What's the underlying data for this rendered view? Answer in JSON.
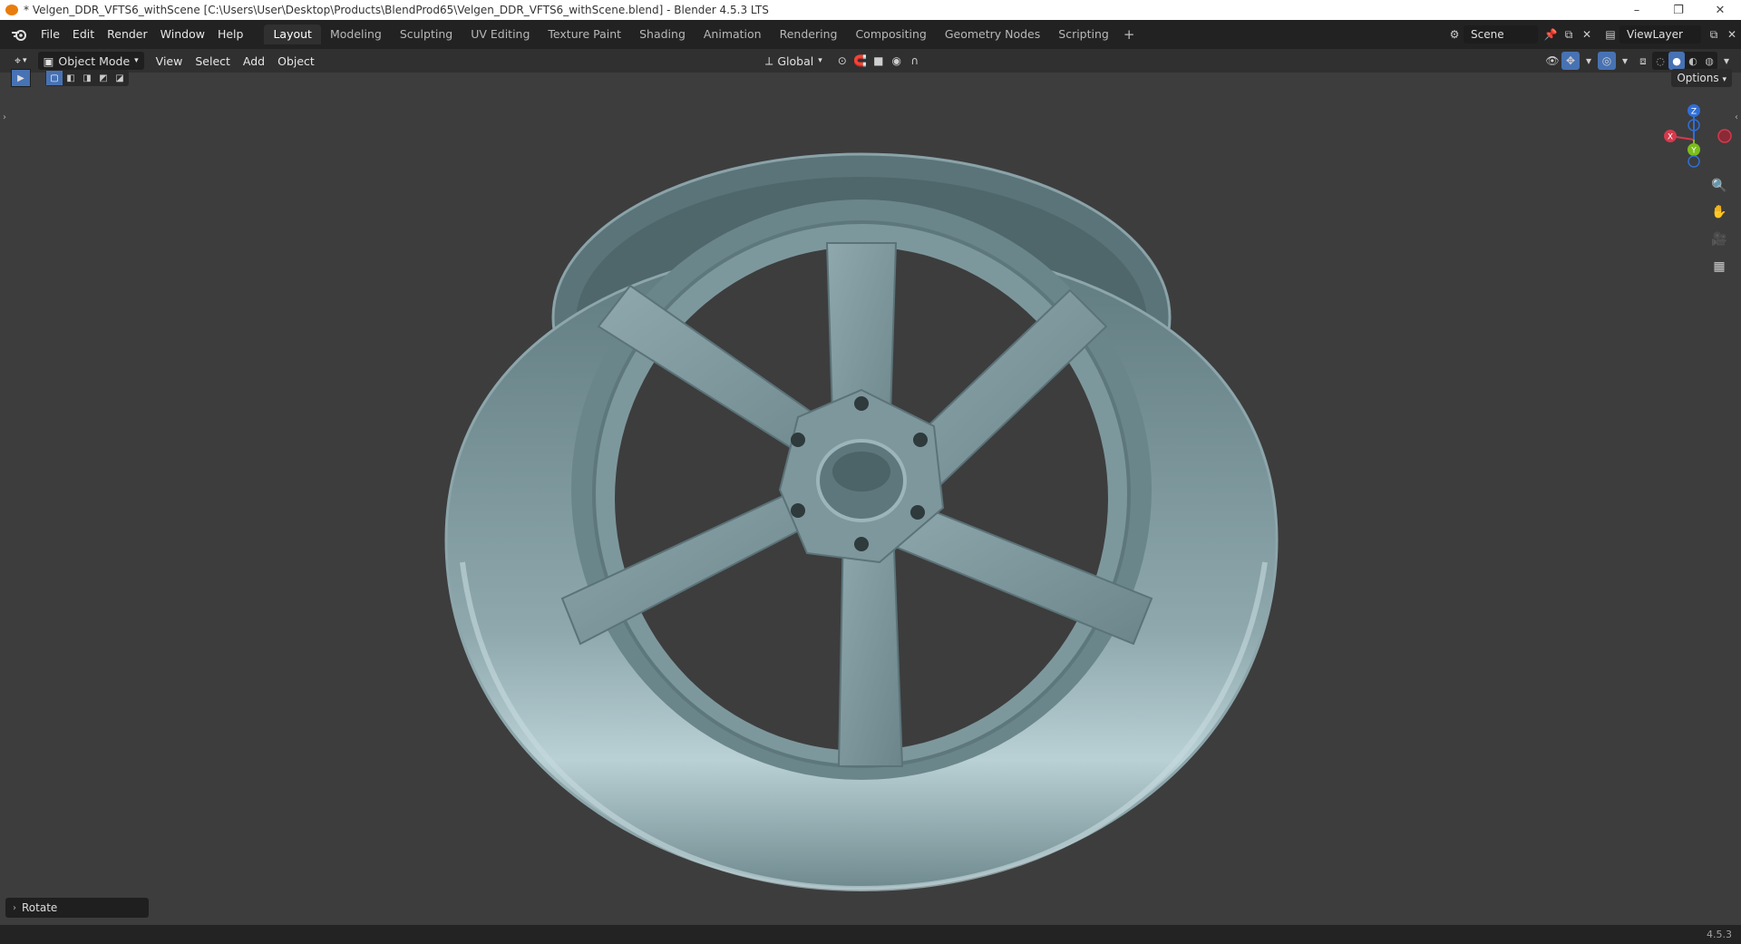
{
  "window": {
    "title": "* Velgen_DDR_VFTS6_withScene [C:\\Users\\User\\Desktop\\Products\\BlendProd65\\Velgen_DDR_VFTS6_withScene.blend] - Blender 4.5.3 LTS",
    "minimize": "–",
    "restore": "❐",
    "close": "✕"
  },
  "menu": {
    "file": "File",
    "edit": "Edit",
    "render": "Render",
    "window": "Window",
    "help": "Help"
  },
  "workspaces": [
    {
      "label": "Layout",
      "active": true
    },
    {
      "label": "Modeling"
    },
    {
      "label": "Sculpting"
    },
    {
      "label": "UV Editing"
    },
    {
      "label": "Texture Paint"
    },
    {
      "label": "Shading"
    },
    {
      "label": "Animation"
    },
    {
      "label": "Rendering"
    },
    {
      "label": "Compositing"
    },
    {
      "label": "Geometry Nodes"
    },
    {
      "label": "Scripting"
    }
  ],
  "workspace_add": "+",
  "scene": {
    "name": "Scene",
    "view_layer": "ViewLayer"
  },
  "header": {
    "mode": "Object Mode",
    "view": "View",
    "select": "Select",
    "add": "Add",
    "object": "Object",
    "orientation": "Global"
  },
  "viewport": {
    "options": "Options",
    "redo_panel": "Rotate",
    "gizmo": {
      "x": "X",
      "y": "Y",
      "z": "Z"
    },
    "object_color": "#7f9aa0"
  },
  "statusbar": {
    "version": "4.5.3"
  },
  "icons": {
    "blender": "blender-logo-icon",
    "editor_type": "editor-type-icon",
    "zoom": "zoom-icon",
    "pan": "hand-pan-icon",
    "camera": "camera-icon",
    "grid": "perspective-grid-icon"
  }
}
